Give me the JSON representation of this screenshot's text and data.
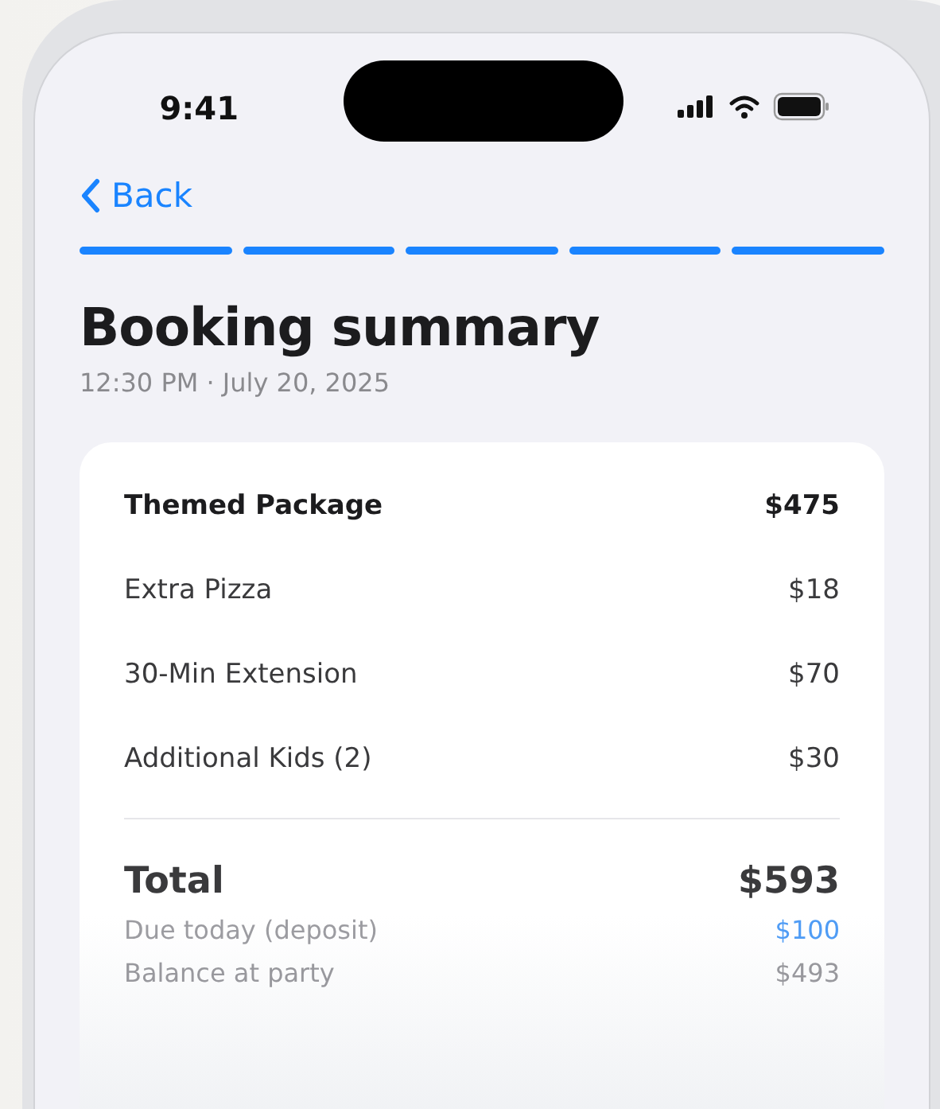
{
  "status_bar": {
    "time": "9:41"
  },
  "nav": {
    "back": "Back"
  },
  "progress_steps": [
    {
      "completed": true
    },
    {
      "completed": true
    },
    {
      "completed": true
    },
    {
      "completed": true
    },
    {
      "completed": true
    }
  ],
  "header": {
    "title": "Booking summary",
    "subtitle": "12:30 PM · July 20, 2025"
  },
  "line_items": [
    {
      "kind": "package",
      "label": "Themed Package",
      "amount": "$475"
    },
    {
      "kind": "extra",
      "label": "Extra Pizza",
      "amount": "$18"
    },
    {
      "kind": "extra",
      "label": "30-Min Extension",
      "amount": "$70"
    },
    {
      "kind": "extra",
      "label": "Additional Kids (2)",
      "amount": "$30"
    }
  ],
  "summary": [
    {
      "kind": "total",
      "label": "Total",
      "amount": "$593"
    },
    {
      "kind": "due",
      "label": "Due today (deposit)",
      "amount": "$100"
    },
    {
      "kind": "balance",
      "label": "Balance at party",
      "amount": "$493"
    }
  ]
}
